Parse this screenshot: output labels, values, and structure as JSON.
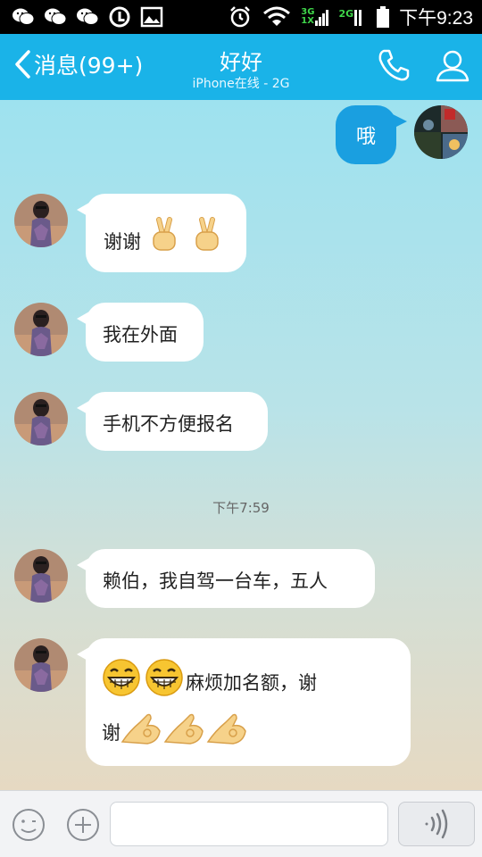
{
  "status_bar": {
    "time": "下午9:23",
    "network_1": "3G",
    "network_2": "2G",
    "network_3": "1X",
    "left_icons": [
      "wechat-icon",
      "wechat-icon",
      "wechat-icon",
      "sync-icon",
      "image-icon"
    ],
    "right_icons": [
      "alarm-icon",
      "wifi-icon",
      "signal-icon",
      "battery-icon"
    ]
  },
  "nav": {
    "back_label": "消息(99+)",
    "title": "好好",
    "subtitle": "iPhone在线 - 2G",
    "call_icon": "phone-icon",
    "profile_icon": "person-icon"
  },
  "messages": {
    "self_1": "哦",
    "m1": "谢谢",
    "m2": "我在外面",
    "m3": "手机不方便报名",
    "timestamp": "下午7:59",
    "m4": "赖伯，我自驾一台车，五人",
    "m5_line1": "麻烦加名额，谢",
    "m5_line2": "谢"
  },
  "colors": {
    "header": "#1ab3e8",
    "self_bubble": "#1a9fe0",
    "other_bubble": "#ffffff"
  }
}
